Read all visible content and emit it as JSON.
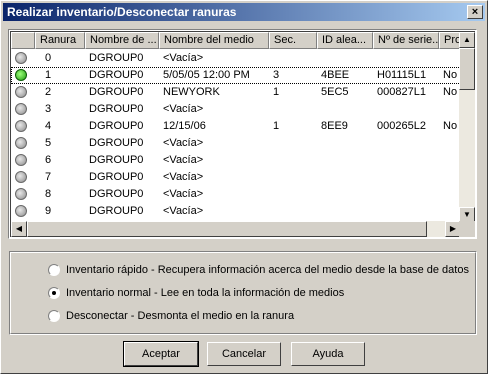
{
  "window": {
    "title": "Realizar inventario/Desconectar ranuras",
    "close_glyph": "×"
  },
  "table": {
    "columns": [
      "",
      "Ranura",
      "Nombre de ...",
      "Nombre del medio",
      "Sec.",
      "ID alea...",
      "Nº de serie...",
      "Prot..."
    ],
    "rows": [
      {
        "status": "off",
        "slot": "0",
        "name": "DGROUP0",
        "media": "<Vacía>",
        "seq": "",
        "id": "",
        "serial": "",
        "prot": ""
      },
      {
        "status": "on",
        "slot": "1",
        "name": "DGROUP0",
        "media": "5/05/05 12:00 PM",
        "seq": "3",
        "id": "4BEE",
        "serial": "H01115L1",
        "prot": "No"
      },
      {
        "status": "off",
        "slot": "2",
        "name": "DGROUP0",
        "media": "NEWYORK",
        "seq": "1",
        "id": "5EC5",
        "serial": "000827L1",
        "prot": "No"
      },
      {
        "status": "off",
        "slot": "3",
        "name": "DGROUP0",
        "media": "<Vacía>",
        "seq": "",
        "id": "",
        "serial": "",
        "prot": ""
      },
      {
        "status": "off",
        "slot": "4",
        "name": "DGROUP0",
        "media": "12/15/06",
        "seq": "1",
        "id": "8EE9",
        "serial": "000265L2",
        "prot": "No"
      },
      {
        "status": "off",
        "slot": "5",
        "name": "DGROUP0",
        "media": "<Vacía>",
        "seq": "",
        "id": "",
        "serial": "",
        "prot": ""
      },
      {
        "status": "off",
        "slot": "6",
        "name": "DGROUP0",
        "media": "<Vacía>",
        "seq": "",
        "id": "",
        "serial": "",
        "prot": ""
      },
      {
        "status": "off",
        "slot": "7",
        "name": "DGROUP0",
        "media": "<Vacía>",
        "seq": "",
        "id": "",
        "serial": "",
        "prot": ""
      },
      {
        "status": "off",
        "slot": "8",
        "name": "DGROUP0",
        "media": "<Vacía>",
        "seq": "",
        "id": "",
        "serial": "",
        "prot": ""
      },
      {
        "status": "off",
        "slot": "9",
        "name": "DGROUP0",
        "media": "<Vacía>",
        "seq": "",
        "id": "",
        "serial": "",
        "prot": ""
      }
    ],
    "selected_row": 1
  },
  "options": {
    "items": [
      "Inventario rápido - Recupera información acerca del medio desde la base de datos",
      "Inventario normal - Lee en toda la información de medios",
      "Desconectar - Desmonta el medio en la ranura"
    ],
    "selected_index": 1
  },
  "buttons": {
    "accept": "Aceptar",
    "cancel": "Cancelar",
    "help": "Ayuda"
  },
  "icons": {
    "scroll_up": "▲",
    "scroll_down": "▼",
    "scroll_left": "◀",
    "scroll_right": "▶",
    "status_on_color": "#1f9a10",
    "status_off_color": "#8a8a8a"
  }
}
